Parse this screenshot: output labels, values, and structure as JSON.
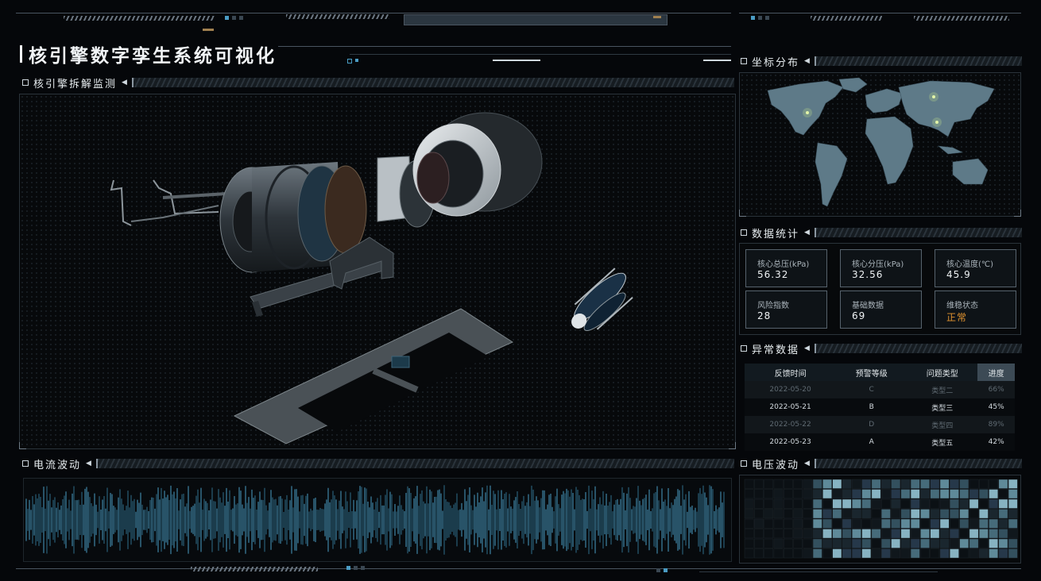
{
  "header": {
    "title": "核引擎数字孪生系统可视化"
  },
  "sections": {
    "disassembly": "核引擎拆解监测",
    "coordinates": "坐标分布",
    "statistics": "数据统计",
    "anomalies": "异常数据",
    "current": "电流波动",
    "voltage": "电压波动"
  },
  "stats": [
    {
      "label": "核心总压(kPa)",
      "value": "56.32"
    },
    {
      "label": "核心分压(kPa)",
      "value": "32.56"
    },
    {
      "label": "核心温度(℃)",
      "value": "45.9"
    },
    {
      "label": "风险指数",
      "value": "28"
    },
    {
      "label": "基础数据",
      "value": "69"
    },
    {
      "label": "维稳状态",
      "value": "正常",
      "color": "#e0932f"
    }
  ],
  "table": {
    "columns": [
      "反馈时间",
      "预警等级",
      "问题类型",
      "进度"
    ],
    "active_column": 3,
    "rows": [
      {
        "date": "2022-05-20",
        "level": "C",
        "type": "类型二",
        "progress": "66%"
      },
      {
        "date": "2022-05-21",
        "level": "B",
        "type": "类型三",
        "progress": "45%"
      },
      {
        "date": "2022-05-22",
        "level": "D",
        "type": "类型四",
        "progress": "89%"
      },
      {
        "date": "2022-05-23",
        "level": "A",
        "type": "类型五",
        "progress": "42%"
      }
    ]
  },
  "colors": {
    "accent": "#4a9cc4",
    "warning": "#e0932f",
    "map_land": "#5e7a88"
  },
  "icons": [
    "engine-model",
    "world-map",
    "map-marker-glow"
  ]
}
